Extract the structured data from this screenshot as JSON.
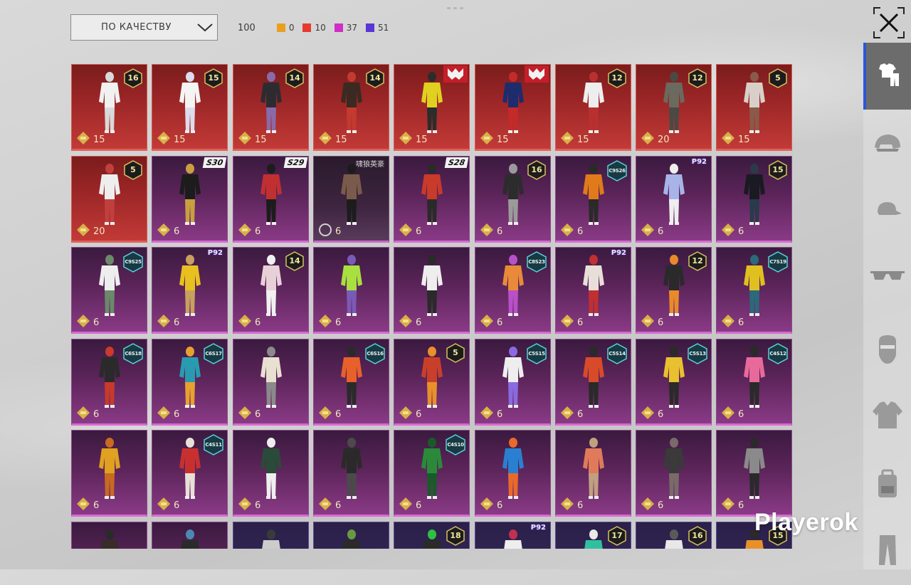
{
  "sort": {
    "label": "ПО КАЧЕСТВУ"
  },
  "counts": {
    "total": "100",
    "items": [
      {
        "color": "#e8a020",
        "value": "0"
      },
      {
        "color": "#e53b2d",
        "value": "10"
      },
      {
        "color": "#cf2fc6",
        "value": "37"
      },
      {
        "color": "#5a35d6",
        "value": "51"
      }
    ]
  },
  "sidebar": {
    "tabs": [
      {
        "icon": "outfit-icon",
        "active": true
      },
      {
        "icon": "helmet-icon"
      },
      {
        "icon": "cap-icon"
      },
      {
        "icon": "glasses-icon"
      },
      {
        "icon": "mask-icon"
      },
      {
        "icon": "jacket-icon"
      },
      {
        "icon": "backpack-icon"
      },
      {
        "icon": "pants-icon"
      }
    ]
  },
  "colors": {
    "legendary": "#b0302f",
    "epic": "#6e2c6c",
    "accent": "#2d55d8"
  },
  "watermark": "Playerok",
  "outfits": [
    {
      "quality": "legendary",
      "badge": "16",
      "price": "15",
      "palette": [
        "#f1f1f1",
        "#d9d9d9"
      ]
    },
    {
      "quality": "legendary",
      "badge": "15",
      "price": "15",
      "palette": [
        "#f4f4f4",
        "#dcdcec"
      ]
    },
    {
      "quality": "legendary",
      "badge": "14",
      "price": "15",
      "palette": [
        "#2c2c30",
        "#8a6aa8"
      ]
    },
    {
      "quality": "legendary",
      "badge": "14",
      "price": "15",
      "palette": [
        "#3a2a22",
        "#c23b2e"
      ]
    },
    {
      "quality": "legendary",
      "tag": "tf",
      "price": "15",
      "palette": [
        "#e0d020",
        "#2c2c2c"
      ]
    },
    {
      "quality": "legendary",
      "tag": "tf",
      "price": "15",
      "palette": [
        "#1c2c6c",
        "#c42a2a"
      ]
    },
    {
      "quality": "legendary",
      "badge": "12",
      "price": "15",
      "palette": [
        "#eeeeee",
        "#b83030"
      ]
    },
    {
      "quality": "legendary",
      "badge": "12",
      "price": "20",
      "palette": [
        "#6a6a5e",
        "#4a4a44"
      ]
    },
    {
      "quality": "legendary",
      "badge": "5",
      "price": "15",
      "palette": [
        "#d8d0c8",
        "#8a5a4a"
      ]
    },
    {
      "quality": "legendary",
      "badge": "5",
      "price": "20",
      "palette": [
        "#eeeeee",
        "#c04040"
      ]
    },
    {
      "quality": "epic",
      "tag": "S30",
      "price": "6",
      "palette": [
        "#1c1c1c",
        "#c8a040"
      ]
    },
    {
      "quality": "epic",
      "tag": "S29",
      "price": "6",
      "palette": [
        "#c03030",
        "#1c1c1c"
      ]
    },
    {
      "quality": "dark-epic",
      "tag": "cn",
      "tagText": "啸狼英豪",
      "price": "6",
      "palette": [
        "#7a5a4a",
        "#1c1c1c"
      ]
    },
    {
      "quality": "epic",
      "tag": "S28",
      "price": "6",
      "palette": [
        "#c83a2a",
        "#2a2a2a"
      ]
    },
    {
      "quality": "epic",
      "badge": "16",
      "price": "6",
      "palette": [
        "#2c2c2c",
        "#9a9a9a"
      ]
    },
    {
      "quality": "epic",
      "season": "C9S26",
      "price": "6",
      "palette": [
        "#e07a1a",
        "#2a2a2a"
      ]
    },
    {
      "quality": "epic",
      "tag": "ppk",
      "tagText": "P92",
      "price": "6",
      "palette": [
        "#a8b4e8",
        "#eeeeee"
      ]
    },
    {
      "quality": "epic",
      "badge": "15",
      "price": "6",
      "palette": [
        "#1a1a22",
        "#2a3a4a"
      ]
    },
    {
      "quality": "epic",
      "season": "C9S25",
      "price": "6",
      "palette": [
        "#eeeeee",
        "#6a8a6a"
      ]
    },
    {
      "quality": "epic",
      "tag": "ppk",
      "tagText": "P92",
      "price": "6",
      "palette": [
        "#e8c020",
        "#c8a060"
      ]
    },
    {
      "quality": "epic",
      "badge": "14",
      "price": "6",
      "palette": [
        "#e8d0d8",
        "#f0f0f0"
      ]
    },
    {
      "quality": "epic",
      "price": "6",
      "palette": [
        "#a8e040",
        "#7a5ab8"
      ]
    },
    {
      "quality": "epic",
      "price": "6",
      "palette": [
        "#eeeeee",
        "#2a2a2a"
      ]
    },
    {
      "quality": "epic",
      "season": "C8S23",
      "price": "6",
      "palette": [
        "#e88a3a",
        "#b850c8"
      ]
    },
    {
      "quality": "epic",
      "tag": "ppk",
      "tagText": "P92",
      "price": "6",
      "palette": [
        "#e8e0d8",
        "#c03030"
      ]
    },
    {
      "quality": "epic",
      "badge": "12",
      "price": "6",
      "palette": [
        "#2a2a2a",
        "#e88a2a"
      ]
    },
    {
      "quality": "epic",
      "season": "C7S19",
      "price": "6",
      "palette": [
        "#e0c020",
        "#2a6a7a"
      ]
    },
    {
      "quality": "epic",
      "season": "C6S18",
      "price": "6",
      "palette": [
        "#2a2a2a",
        "#c83a2a"
      ]
    },
    {
      "quality": "epic",
      "season": "C6S17",
      "price": "6",
      "palette": [
        "#2a9ab0",
        "#e8a030"
      ]
    },
    {
      "quality": "epic",
      "price": "6",
      "palette": [
        "#e8e0d0",
        "#8a8a8a"
      ]
    },
    {
      "quality": "epic",
      "season": "C6S16",
      "price": "6",
      "palette": [
        "#e8602a",
        "#2a2a2a"
      ]
    },
    {
      "quality": "epic",
      "badge": "5",
      "price": "6",
      "palette": [
        "#c8402a",
        "#e8902a"
      ]
    },
    {
      "quality": "epic",
      "season": "C5S15",
      "price": "6",
      "palette": [
        "#eeeeee",
        "#8a6ae0"
      ]
    },
    {
      "quality": "epic",
      "season": "C5S14",
      "price": "6",
      "palette": [
        "#d84a2a",
        "#2a2a2a"
      ]
    },
    {
      "quality": "epic",
      "season": "C5S13",
      "price": "6",
      "palette": [
        "#e8c030",
        "#2a2a2a"
      ]
    },
    {
      "quality": "epic",
      "season": "C4S12",
      "price": "6",
      "palette": [
        "#e86a9a",
        "#2a2a2a"
      ]
    },
    {
      "quality": "epic",
      "price": "6",
      "palette": [
        "#e0a020",
        "#c86a20"
      ]
    },
    {
      "quality": "epic",
      "season": "C4S11",
      "price": "6",
      "palette": [
        "#c83030",
        "#e8e0d8"
      ]
    },
    {
      "quality": "epic",
      "price": "6",
      "palette": [
        "#2a4a3a",
        "#eeeeee"
      ]
    },
    {
      "quality": "epic",
      "price": "6",
      "palette": [
        "#2a2a2a",
        "#4a4a4a"
      ]
    },
    {
      "quality": "epic",
      "season": "C4S10",
      "price": "6",
      "palette": [
        "#2a8a3a",
        "#1a5a2a"
      ]
    },
    {
      "quality": "epic",
      "price": "6",
      "palette": [
        "#2a80d0",
        "#e86a2a"
      ]
    },
    {
      "quality": "epic",
      "price": "6",
      "palette": [
        "#e07a5a",
        "#c0a080"
      ]
    },
    {
      "quality": "epic",
      "price": "6",
      "palette": [
        "#3a3a3a",
        "#7a6a6a"
      ]
    },
    {
      "quality": "epic",
      "price": "6",
      "palette": [
        "#8a8a8a",
        "#2a2a2a"
      ]
    },
    {
      "quality": "epic",
      "price": "",
      "palette": [
        "#3a2a2a",
        "#2a2a2a"
      ]
    },
    {
      "quality": "epic",
      "price": "",
      "palette": [
        "#2a2a2a",
        "#4a8ab0"
      ]
    },
    {
      "quality": "ext-purple",
      "price": "",
      "palette": [
        "#cccccc",
        "#3a3a3a"
      ]
    },
    {
      "quality": "ext-purple",
      "price": "",
      "palette": [
        "#2a2a2a",
        "#6a9a40"
      ]
    },
    {
      "quality": "ext-purple",
      "badge": "18",
      "price": "",
      "palette": [
        "#2a2a2a",
        "#30c040"
      ]
    },
    {
      "quality": "ext-purple",
      "tag": "ppk",
      "tagText": "P92",
      "price": "",
      "palette": [
        "#eeeeee",
        "#c03050"
      ]
    },
    {
      "quality": "ext-purple",
      "badge": "17",
      "price": "",
      "palette": [
        "#30c0a0",
        "#e8e8e8"
      ]
    },
    {
      "quality": "ext-purple",
      "badge": "16",
      "price": "",
      "palette": [
        "#e8e8e8",
        "#5a5a5a"
      ]
    },
    {
      "quality": "ext-purple",
      "badge": "15",
      "price": "",
      "palette": [
        "#e8902a",
        "#2a2a2a"
      ]
    }
  ]
}
